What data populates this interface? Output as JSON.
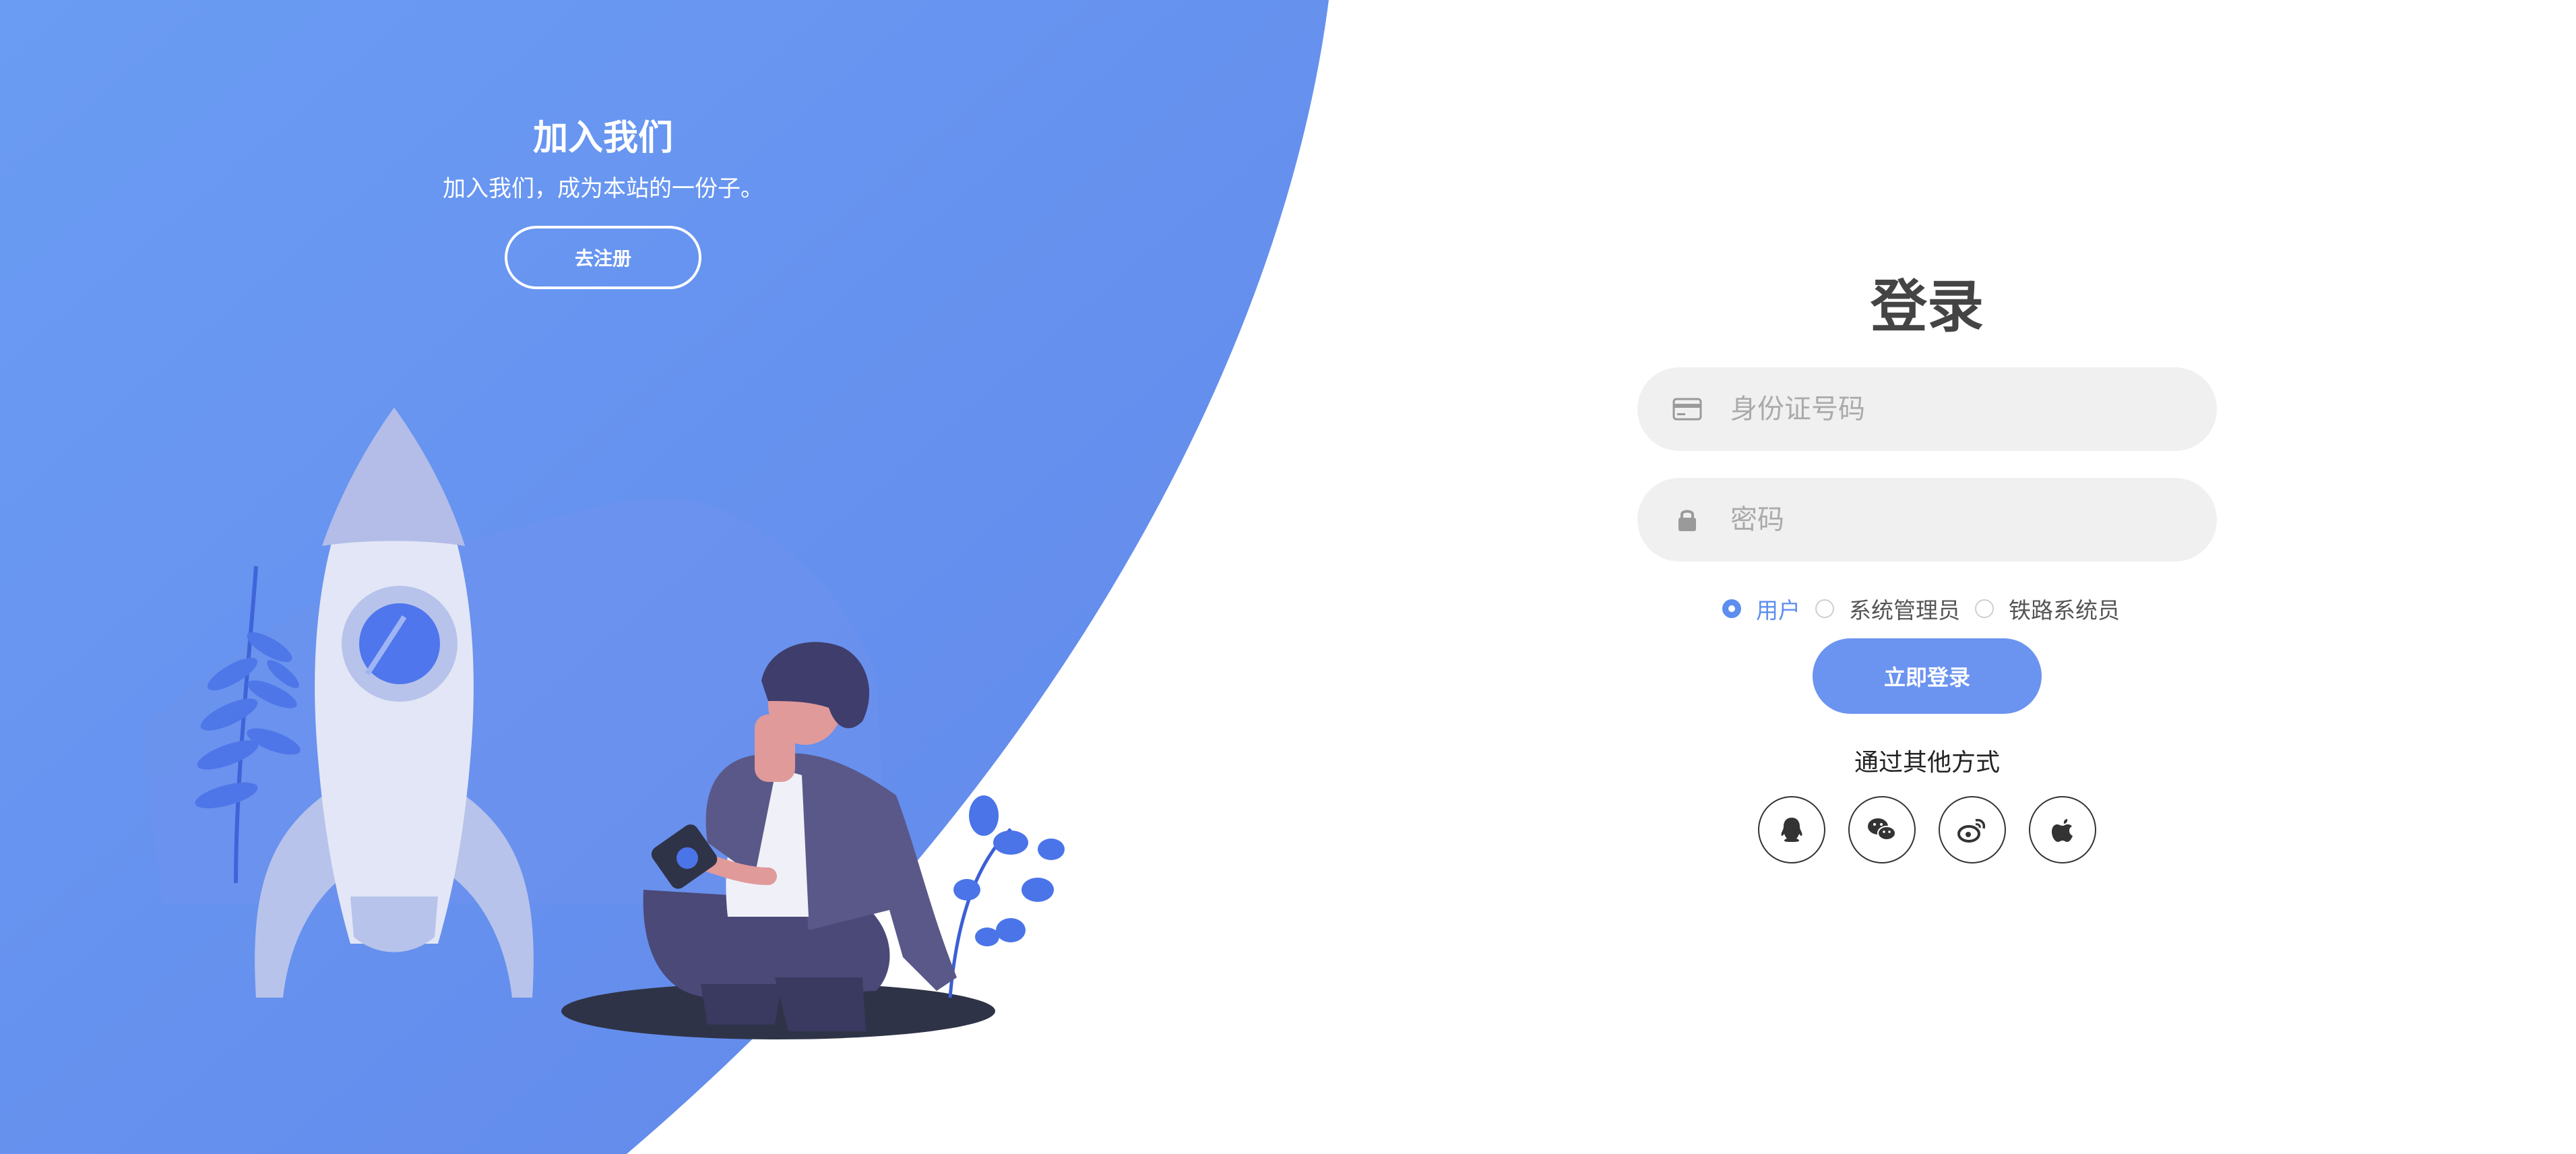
{
  "colors": {
    "primary_blue": "#6597ef",
    "button_blue": "#6b93f0",
    "accent": "#5c8eee",
    "input_bg": "#f0f0f0"
  },
  "left_panel": {
    "title": "加入我们",
    "subtitle": "加入我们，成为本站的一份子。",
    "register_button": "去注册"
  },
  "login": {
    "title": "登录",
    "id_field": {
      "icon": "id-card-icon",
      "placeholder": "身份证号码",
      "value": ""
    },
    "password_field": {
      "icon": "lock-icon",
      "placeholder": "密码",
      "value": ""
    },
    "roles": [
      {
        "label": "用户",
        "selected": true
      },
      {
        "label": "系统管理员",
        "selected": false
      },
      {
        "label": "铁路系统员",
        "selected": false
      }
    ],
    "submit_button": "立即登录",
    "other_methods_title": "通过其他方式",
    "socials": [
      {
        "name": "qq-icon"
      },
      {
        "name": "wechat-icon"
      },
      {
        "name": "weibo-icon"
      },
      {
        "name": "apple-icon"
      }
    ]
  }
}
